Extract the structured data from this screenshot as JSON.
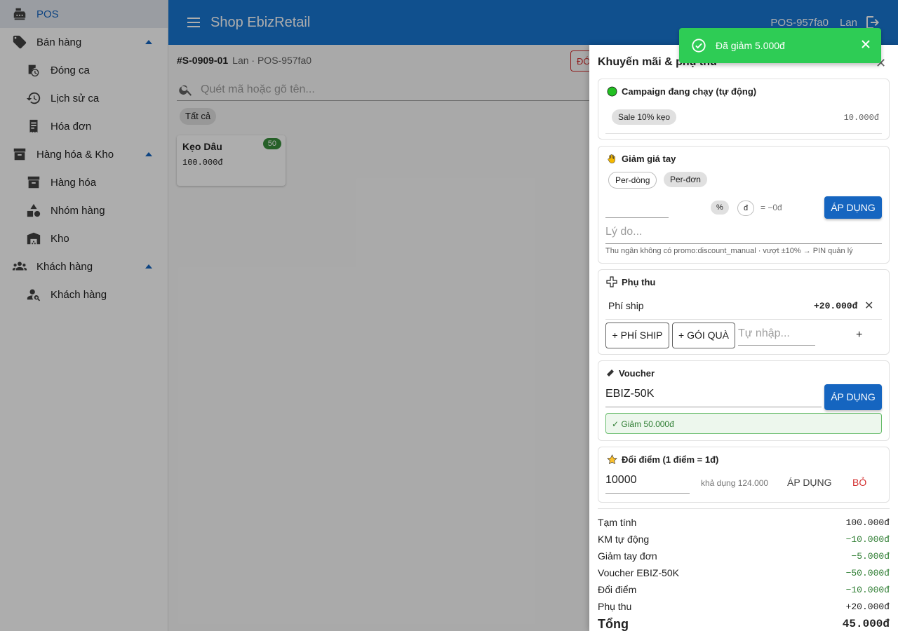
{
  "sidebar": {
    "items": [
      {
        "label": "POS",
        "icon": "cash-register-icon"
      },
      {
        "label": "Bán hàng",
        "icon": "tag-icon"
      },
      {
        "label": "Đóng ca",
        "icon": "clock-lock-icon"
      },
      {
        "label": "Lịch sử ca",
        "icon": "history-icon"
      },
      {
        "label": "Hóa đơn",
        "icon": "receipt-icon"
      },
      {
        "label": "Hàng hóa & Kho",
        "icon": "archive-icon"
      },
      {
        "label": "Hàng hóa",
        "icon": "archive-icon"
      },
      {
        "label": "Nhóm hàng",
        "icon": "shapes-icon"
      },
      {
        "label": "Kho",
        "icon": "warehouse-icon"
      },
      {
        "label": "Khách hàng",
        "icon": "people-icon"
      },
      {
        "label": "Khách hàng",
        "icon": "person-search-icon"
      }
    ]
  },
  "header": {
    "title": "Shop EbizRetail",
    "pos_id": "POS-957fa0",
    "user": "Lan"
  },
  "order": {
    "code": "#S-0909-01",
    "meta": "Lan · POS-957fa0",
    "red_button": "ĐÓ"
  },
  "search": {
    "placeholder": "Quét mã hoặc gõ tên..."
  },
  "filter": {
    "all": "Tất cả"
  },
  "product": {
    "name": "Kẹo Dâu",
    "price": "100.000đ",
    "stock": "50"
  },
  "toast": {
    "message": "Đã giảm 5.000đ",
    "color": "#2ecc55"
  },
  "drawer": {
    "title": "Khuyến mãi & phụ thu",
    "campaign": {
      "title": "Campaign đang chạy (tự động)",
      "chip": "Sale 10% kẹo",
      "amount": "10.000đ"
    },
    "manual": {
      "title": "Giảm giá tay",
      "mode_line": "Per-dòng",
      "mode_order": "Per-đơn",
      "unit_percent": "%",
      "unit_vnd": "đ",
      "preview": "= −0đ",
      "apply": "ÁP DỤNG",
      "reason_placeholder": "Lý do...",
      "note": "Thu ngân không có promo:discount_manual · vượt ±10% → PIN quản lý"
    },
    "surcharge": {
      "title": "Phụ thu",
      "item_label": "Phí ship",
      "item_amount": "+20.000đ",
      "btn_ship": "+ PHÍ SHIP",
      "btn_gift": "+ GÓI QUÀ",
      "custom_placeholder": "Tự nhập...",
      "add": "+"
    },
    "voucher": {
      "title": "Voucher",
      "code": "EBIZ-50K",
      "apply": "ÁP DỤNG",
      "result": "✓ Giảm 50.000đ"
    },
    "points": {
      "title": "Đổi điểm (1 điểm = 1đ)",
      "value": "10000",
      "available": "khả dụng 124.000",
      "apply": "ÁP DỤNG",
      "remove": "BỎ"
    }
  },
  "totals": {
    "rows": [
      {
        "label": "Tạm tính",
        "value": "100.000đ"
      },
      {
        "label": "KM tự động",
        "value": "−10.000đ"
      },
      {
        "label": "Giảm tay đơn",
        "value": "−5.000đ"
      },
      {
        "label": "Voucher EBIZ-50K",
        "value": "−50.000đ"
      },
      {
        "label": "Đổi điểm",
        "value": "−10.000đ"
      },
      {
        "label": "Phụ thu",
        "value": "+20.000đ"
      }
    ],
    "total_label": "Tổng",
    "total_value": "45.000đ"
  }
}
